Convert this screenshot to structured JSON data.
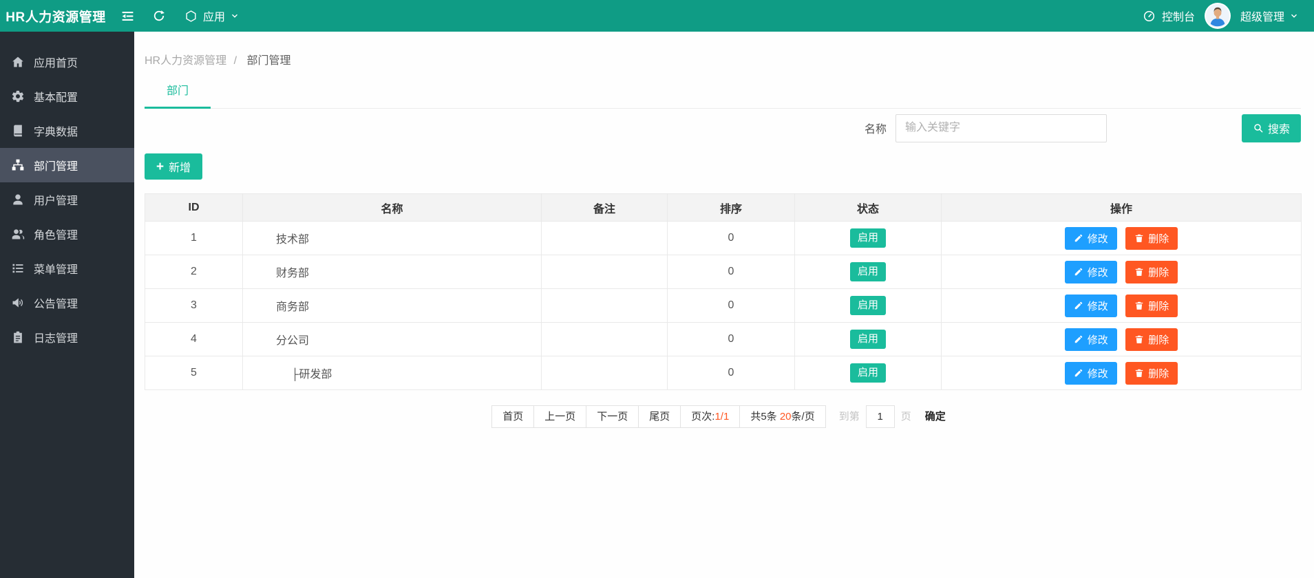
{
  "colors": {
    "topbar": "#0f9c85",
    "accent": "#1abc9c",
    "edit_blue": "#1e9fff",
    "danger": "#ff5722",
    "sidebar_bg": "#262d34",
    "sidebar_active": "#4a515f"
  },
  "topbar": {
    "brand": "HR人力资源管理",
    "app_menu_label": "应用",
    "console_label": "控制台",
    "user_label": "超级管理"
  },
  "sidebar": {
    "items": [
      {
        "label": "应用首页",
        "icon": "home-icon",
        "active": false
      },
      {
        "label": "基本配置",
        "icon": "gear-icon",
        "active": false
      },
      {
        "label": "字典数据",
        "icon": "book-icon",
        "active": false
      },
      {
        "label": "部门管理",
        "icon": "sitemap-icon",
        "active": true
      },
      {
        "label": "用户管理",
        "icon": "user-icon",
        "active": false
      },
      {
        "label": "角色管理",
        "icon": "users-icon",
        "active": false
      },
      {
        "label": "菜单管理",
        "icon": "list-icon",
        "active": false
      },
      {
        "label": "公告管理",
        "icon": "speaker-icon",
        "active": false
      },
      {
        "label": "日志管理",
        "icon": "clipboard-icon",
        "active": false
      }
    ]
  },
  "breadcrumb": {
    "root": "HR人力资源管理",
    "separator": "/",
    "current": "部门管理"
  },
  "tab": {
    "label": "部门"
  },
  "search": {
    "label": "名称",
    "placeholder": "输入关键字",
    "button": "搜索"
  },
  "toolbar": {
    "add_icon": "+",
    "add_label": "新增"
  },
  "table": {
    "headers": [
      "ID",
      "名称",
      "备注",
      "排序",
      "状态",
      "操作"
    ],
    "actions": {
      "edit": "修改",
      "delete": "删除"
    },
    "rows": [
      {
        "id": "1",
        "name": "技术部",
        "remark": "",
        "sort": "0",
        "status": "启用"
      },
      {
        "id": "2",
        "name": "财务部",
        "remark": "",
        "sort": "0",
        "status": "启用"
      },
      {
        "id": "3",
        "name": "商务部",
        "remark": "",
        "sort": "0",
        "status": "启用"
      },
      {
        "id": "4",
        "name": "分公司",
        "remark": "",
        "sort": "0",
        "status": "启用"
      },
      {
        "id": "5",
        "name": "├研发部",
        "remark": "",
        "sort": "0",
        "status": "启用"
      }
    ]
  },
  "pagination": {
    "first": "首页",
    "prev": "上一页",
    "next": "下一页",
    "last": "尾页",
    "page_label": "页次:",
    "page_value": "1/1",
    "total_label": "共5条",
    "per_page_value": "20",
    "per_page_unit": "条/页",
    "goto_label": "到第",
    "goto_value": "1",
    "goto_unit": "页",
    "confirm": "确定"
  }
}
